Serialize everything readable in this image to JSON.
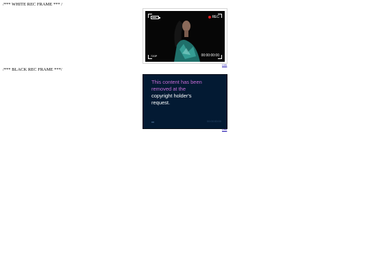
{
  "headings": {
    "white_frame": "/*** WHITE REC FRAME *** /",
    "black_frame": "/*** BLACK REC FRAME ***/"
  },
  "white_frame": {
    "rec_label": "REC",
    "resolution": "720P",
    "timecode": "00:00:00:00",
    "link": "Link"
  },
  "black_frame": {
    "message_line1": "This content has been",
    "message_line2": "removed at the",
    "message_line3": "copyright holder's",
    "message_line4": "request.",
    "timecode": "00:00:00:00",
    "link": "Link"
  },
  "colors": {
    "rec_dot": "#e21b1b",
    "black_frame_bg": "#031a33",
    "removed_text_pink": "#c86bd6"
  }
}
